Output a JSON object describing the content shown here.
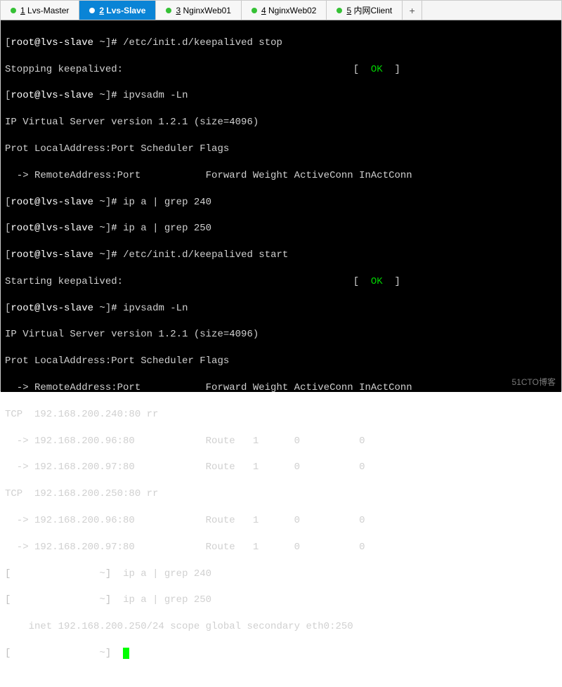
{
  "tabs": [
    {
      "num": "1",
      "label": "Lvs-Master"
    },
    {
      "num": "2",
      "label": "Lvs-Slave"
    },
    {
      "num": "3",
      "label": "NginxWeb01"
    },
    {
      "num": "4",
      "label": "NginxWeb02"
    },
    {
      "num": "5",
      "label": "内网Client"
    }
  ],
  "addtab": "+",
  "prompt": {
    "open": "[",
    "user": "root@lvs-slave",
    "path": " ~",
    "close": "]",
    "hash": "# "
  },
  "cmd": {
    "stop": "/etc/init.d/keepalived stop",
    "start": "/etc/init.d/keepalived start",
    "ipvsadm": "ipvsadm -Ln",
    "ipa240": "ip a | grep 240",
    "ipa250": "ip a | grep 250"
  },
  "out": {
    "stopping": "Stopping keepalived:",
    "starting": "Starting keepalived:",
    "ok_open": "[  ",
    "ok": "OK",
    "ok_close": "  ]",
    "version": "IP Virtual Server version 1.2.1 (size=4096)",
    "header1": "Prot LocalAddress:Port Scheduler Flags",
    "header2": "  -> RemoteAddress:Port           Forward Weight ActiveConn InActConn",
    "tcp240": "TCP  192.168.200.240:80 rr",
    "tcp250": "TCP  192.168.200.250:80 rr",
    "rs96": "  -> 192.168.200.96:80            Route   1      0          0         ",
    "rs97": "  -> 192.168.200.97:80            Route   1      0          0         ",
    "inet250": "    inet 192.168.200.250/24 scope global secondary eth0:250"
  },
  "watermark": "51CTO博客"
}
